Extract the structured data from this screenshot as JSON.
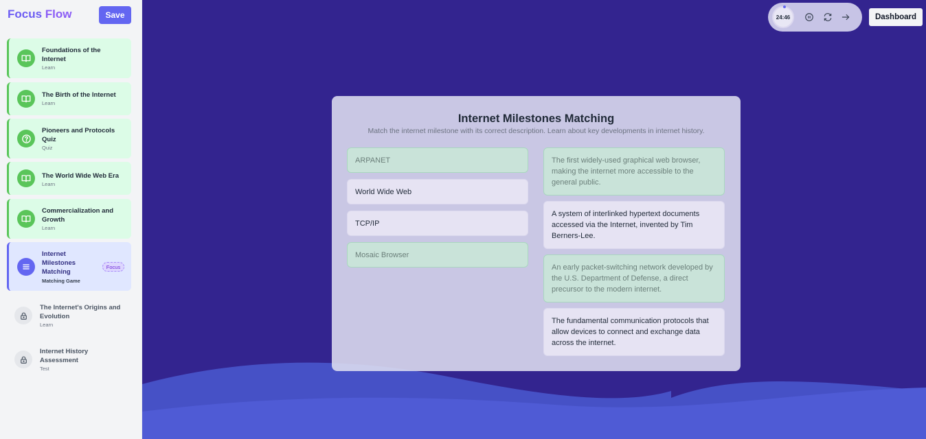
{
  "app": {
    "brand_part1": "Focus",
    "brand_part2": "Flow",
    "save_label": "Save",
    "dashboard_label": "Dashboard"
  },
  "timer": {
    "display": "24:46"
  },
  "sidebar": {
    "items": [
      {
        "title": "Foundations of the Internet",
        "subtitle": "Learn",
        "status": "completed",
        "icon": "book-icon"
      },
      {
        "title": "The Birth of the Internet",
        "subtitle": "Learn",
        "status": "completed",
        "icon": "book-icon"
      },
      {
        "title": "Pioneers and Protocols Quiz",
        "subtitle": "Quiz",
        "status": "completed",
        "icon": "question-icon"
      },
      {
        "title": "The World Wide Web Era",
        "subtitle": "Learn",
        "status": "completed",
        "icon": "book-icon"
      },
      {
        "title": "Commercialization and Growth",
        "subtitle": "Learn",
        "status": "completed",
        "icon": "book-icon"
      },
      {
        "title": "Internet Milestones Matching",
        "subtitle": "Matching Game",
        "status": "active",
        "badge": "Focus",
        "icon": "list-icon"
      },
      {
        "title": "The Internet's Origins and Evolution",
        "subtitle": "Learn",
        "status": "locked",
        "icon": "lock-icon"
      },
      {
        "title": "Internet History Assessment",
        "subtitle": "Test",
        "status": "locked",
        "icon": "lock-icon"
      }
    ]
  },
  "game": {
    "title": "Internet Milestones Matching",
    "subtitle": "Match the internet milestone with its correct description. Learn about key developments in internet history.",
    "terms": [
      {
        "label": "ARPANET",
        "state": "matched"
      },
      {
        "label": "World Wide Web",
        "state": "open"
      },
      {
        "label": "TCP/IP",
        "state": "open"
      },
      {
        "label": "Mosaic Browser",
        "state": "matched"
      }
    ],
    "descriptions": [
      {
        "text": "The first widely-used graphical web browser, making the internet more accessible to the general public.",
        "state": "matched"
      },
      {
        "text": "A system of interlinked hypertext documents accessed via the Internet, invented by Tim Berners-Lee.",
        "state": "open"
      },
      {
        "text": "An early packet-switching network developed by the U.S. Department of Defense, a direct precursor to the modern internet.",
        "state": "matched"
      },
      {
        "text": "The fundamental communication protocols that allow devices to connect and exchange data across the internet.",
        "state": "open"
      }
    ]
  },
  "colors": {
    "accent": "#6366f1",
    "completed": "#5ac55a",
    "background": "#33248f",
    "wave": "#4f5bd5"
  }
}
